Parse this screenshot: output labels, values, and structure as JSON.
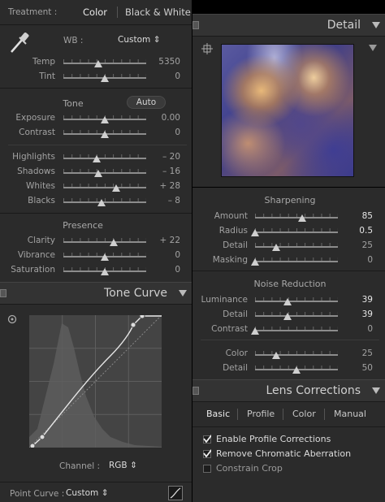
{
  "left": {
    "treatment": {
      "label": "Treatment :",
      "color": "Color",
      "bw": "Black & White"
    },
    "wb": {
      "label": "WB :",
      "value": "Custom ⇕"
    },
    "wb_sliders": [
      {
        "label": "Temp",
        "value": "5350",
        "pos": 0.42
      },
      {
        "label": "Tint",
        "value": "0",
        "pos": 0.5
      }
    ],
    "tone": {
      "title": "Tone",
      "auto": "Auto"
    },
    "tone_sliders": [
      {
        "label": "Exposure",
        "value": "0.00",
        "pos": 0.5
      },
      {
        "label": "Contrast",
        "value": "0",
        "pos": 0.5
      }
    ],
    "tone_sliders2": [
      {
        "label": "Highlights",
        "value": "– 20",
        "pos": 0.4
      },
      {
        "label": "Shadows",
        "value": "– 16",
        "pos": 0.42
      },
      {
        "label": "Whites",
        "value": "+ 28",
        "pos": 0.64
      },
      {
        "label": "Blacks",
        "value": "– 8",
        "pos": 0.46
      }
    ],
    "presence": {
      "title": "Presence"
    },
    "presence_sliders": [
      {
        "label": "Clarity",
        "value": "+ 22",
        "pos": 0.61
      },
      {
        "label": "Vibrance",
        "value": "0",
        "pos": 0.5
      },
      {
        "label": "Saturation",
        "value": "0",
        "pos": 0.5
      }
    ],
    "tone_curve": {
      "title": "Tone Curve",
      "channel_label": "Channel :",
      "channel_value": "RGB ⇕",
      "point_curve_label": "Point Curve :",
      "point_curve_value": "Custom ⇕"
    }
  },
  "right": {
    "detail": {
      "title": "Detail"
    },
    "sharpening": {
      "title": "Sharpening"
    },
    "sharp_sliders": [
      {
        "label": "Amount",
        "value": "85",
        "pos": 0.57,
        "hi": true
      },
      {
        "label": "Radius",
        "value": "0.5",
        "pos": 0.0,
        "hi": true
      },
      {
        "label": "Detail",
        "value": "25",
        "pos": 0.25,
        "hi": false
      },
      {
        "label": "Masking",
        "value": "0",
        "pos": 0.0,
        "hi": false
      }
    ],
    "noise": {
      "title": "Noise Reduction"
    },
    "noise_sliders": [
      {
        "label": "Luminance",
        "value": "39",
        "pos": 0.39,
        "hi": true
      },
      {
        "label": "Detail",
        "value": "39",
        "pos": 0.39,
        "hi": true
      },
      {
        "label": "Contrast",
        "value": "0",
        "pos": 0.0,
        "hi": false
      }
    ],
    "noise_sliders2": [
      {
        "label": "Color",
        "value": "25",
        "pos": 0.25,
        "hi": false
      },
      {
        "label": "Detail",
        "value": "50",
        "pos": 0.5,
        "hi": false
      }
    ],
    "lens": {
      "title": "Lens Corrections",
      "tabs": [
        "Basic",
        "Profile",
        "Color",
        "Manual"
      ]
    },
    "lens_checks": [
      {
        "label": "Enable Profile Corrections",
        "checked": true
      },
      {
        "label": "Remove Chromatic Aberration",
        "checked": true
      },
      {
        "label": "Constrain Crop",
        "checked": false
      }
    ]
  }
}
